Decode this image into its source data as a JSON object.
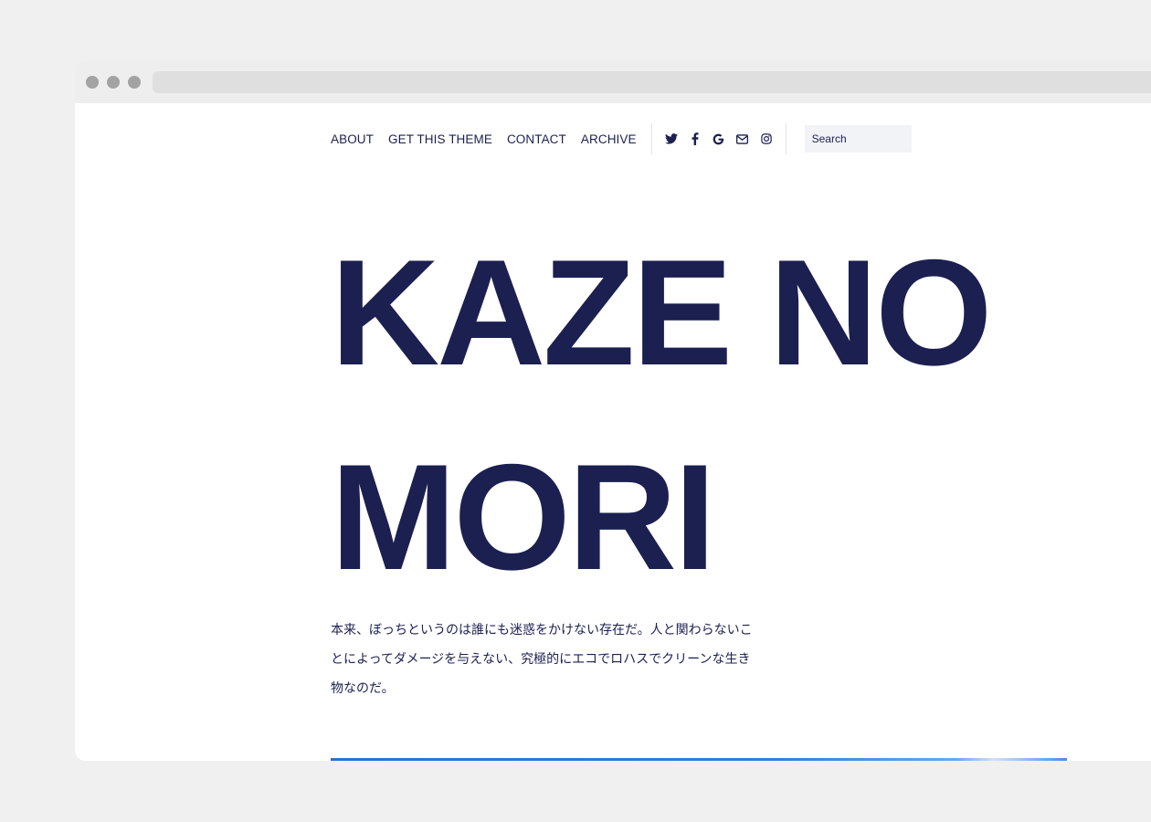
{
  "nav": {
    "links": [
      "ABOUT",
      "GET THIS THEME",
      "CONTACT",
      "ARCHIVE"
    ],
    "social_icons": [
      "twitter-icon",
      "facebook-icon",
      "google-icon",
      "mail-icon",
      "instagram-icon"
    ],
    "search_placeholder": "Search"
  },
  "hero": {
    "title_line1": "KAZE NO",
    "title_line2": "MORI"
  },
  "intro": {
    "text": "本来、ぼっちというのは誰にも迷惑をかけない存在だ。人と関わらないことによってダメージを与えない、究極的にエコでロハスでクリーンな生き物なのだ。"
  },
  "colors": {
    "text": "#1b2050",
    "accent": "#2f6fd0",
    "page_bg": "#f0f0f0"
  }
}
